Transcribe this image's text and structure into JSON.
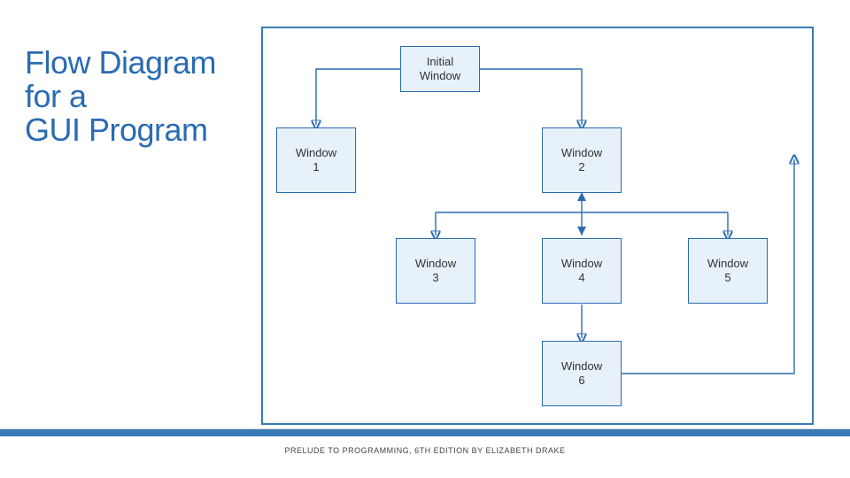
{
  "title": {
    "line1": "Flow Diagram",
    "line2": "for a",
    "line3": "GUI Program"
  },
  "footer": "PRELUDE TO PROGRAMMING, 6TH EDITION BY ELIZABETH DRAKE",
  "nodes": {
    "initial": {
      "l1": "Initial",
      "l2": "Window"
    },
    "w1": {
      "l1": "Window",
      "l2": "1"
    },
    "w2": {
      "l1": "Window",
      "l2": "2"
    },
    "w3": {
      "l1": "Window",
      "l2": "3"
    },
    "w4": {
      "l1": "Window",
      "l2": "4"
    },
    "w5": {
      "l1": "Window",
      "l2": "5"
    },
    "w6": {
      "l1": "Window",
      "l2": "6"
    }
  },
  "chart_data": {
    "type": "flow-diagram",
    "title": "Flow Diagram for a GUI Program",
    "nodes": [
      {
        "id": "initial",
        "label": "Initial Window"
      },
      {
        "id": "w1",
        "label": "Window 1"
      },
      {
        "id": "w2",
        "label": "Window 2"
      },
      {
        "id": "w3",
        "label": "Window 3"
      },
      {
        "id": "w4",
        "label": "Window 4"
      },
      {
        "id": "w5",
        "label": "Window 5"
      },
      {
        "id": "w6",
        "label": "Window 6"
      }
    ],
    "edges": [
      {
        "from": "initial",
        "to": "w1"
      },
      {
        "from": "initial",
        "to": "w2"
      },
      {
        "from": "w2",
        "to": "w3"
      },
      {
        "from": "w2",
        "to": "w4",
        "bidirectional": true
      },
      {
        "from": "w2",
        "to": "w5"
      },
      {
        "from": "w4",
        "to": "w6"
      },
      {
        "from": "w6",
        "to": "w2",
        "via": "right-loop"
      }
    ]
  }
}
